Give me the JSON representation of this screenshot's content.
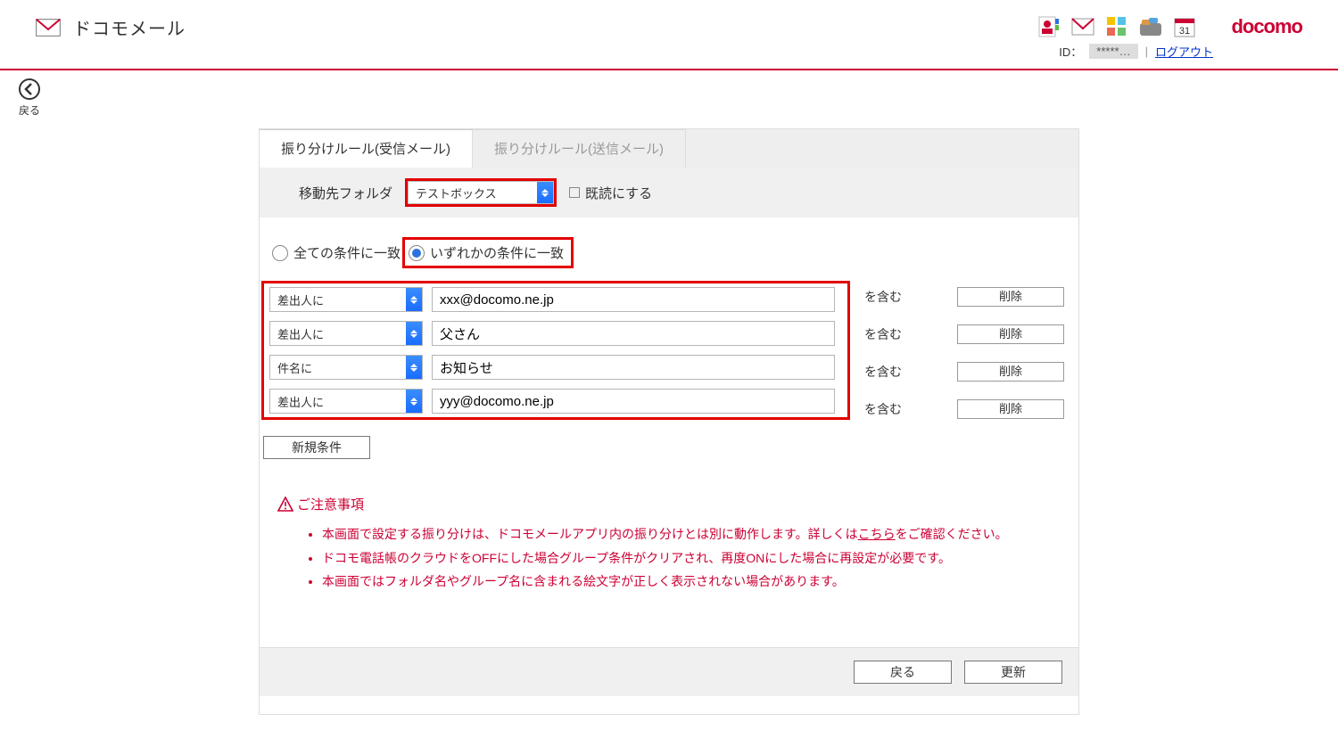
{
  "brand": {
    "title": "ドコモメール"
  },
  "header": {
    "id_label": "ID：",
    "id_value": "*****…",
    "logout": "ログアウト",
    "docomo_logo": "docomo"
  },
  "back": {
    "label": "戻る"
  },
  "tabs": {
    "inbox": "振り分けルール(受信メール)",
    "outbox": "振り分けルール(送信メール)"
  },
  "folder": {
    "label": "移動先フォルダ",
    "selected": "テストボックス",
    "mark_read": "既読にする"
  },
  "match": {
    "all": "全ての条件に一致",
    "any": "いずれかの条件に一致"
  },
  "conditions": [
    {
      "field": "差出人に",
      "value": "xxx@docomo.ne.jp",
      "suffix": "を含む"
    },
    {
      "field": "差出人に",
      "value": "父さん",
      "suffix": "を含む"
    },
    {
      "field": "件名に",
      "value": "お知らせ",
      "suffix": "を含む"
    },
    {
      "field": "差出人に",
      "value": "yyy@docomo.ne.jp",
      "suffix": "を含む"
    }
  ],
  "buttons": {
    "delete": "削除",
    "add_condition": "新規条件",
    "back": "戻る",
    "update": "更新"
  },
  "notes_title": "ご注意事項",
  "notes": [
    {
      "pre": "本画面で設定する振り分けは、ドコモメールアプリ内の振り分けとは別に動作します。詳しくは",
      "link": "こちら",
      "post": "をご確認ください。"
    },
    {
      "text": "ドコモ電話帳のクラウドをOFFにした場合グループ条件がクリアされ、再度ONにした場合に再設定が必要です。"
    },
    {
      "text": "本画面ではフォルダ名やグループ名に含まれる絵文字が正しく表示されない場合があります。"
    }
  ]
}
